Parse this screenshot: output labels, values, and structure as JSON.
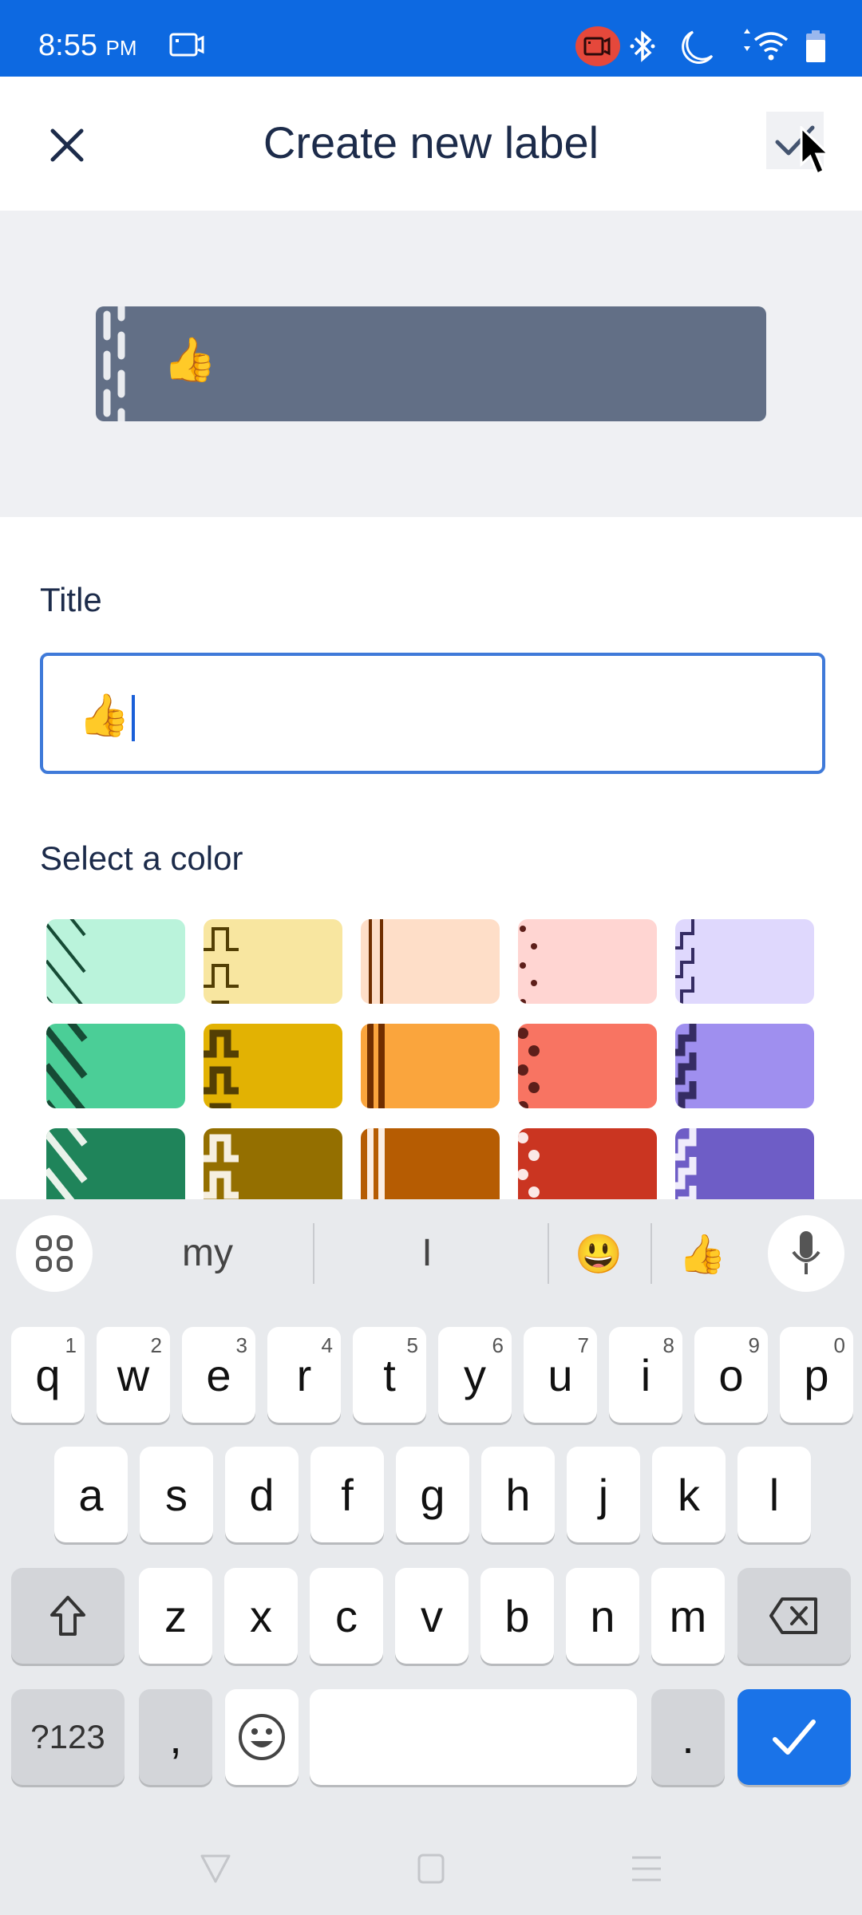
{
  "status_bar": {
    "time": "8:55",
    "ampm": "PM",
    "icons": [
      "screen-record-icon",
      "recording-indicator-icon",
      "bluetooth-icon",
      "do-not-disturb-icon",
      "wifi-icon",
      "battery-icon"
    ]
  },
  "app_bar": {
    "title": "Create new label",
    "close_icon": "close-icon",
    "done_icon": "check-icon"
  },
  "preview": {
    "label_text": "👍",
    "label_color": "#626f86"
  },
  "form": {
    "title_label": "Title",
    "title_value": "👍",
    "color_label": "Select a color"
  },
  "colors": [
    {
      "name": "green-subtle",
      "bg": "#baf3db",
      "pattern": "diagonal",
      "fg": "#164b35"
    },
    {
      "name": "yellow-subtle",
      "bg": "#f8e6a0",
      "pattern": "pulse",
      "fg": "#533f04"
    },
    {
      "name": "orange-subtle",
      "bg": "#fedec8",
      "pattern": "vlines",
      "fg": "#702e00"
    },
    {
      "name": "red-subtle",
      "bg": "#ffd5d2",
      "pattern": "dots",
      "fg": "#5d1f1a"
    },
    {
      "name": "purple-subtle",
      "bg": "#dfd8fd",
      "pattern": "steps",
      "fg": "#352c63"
    },
    {
      "name": "green",
      "bg": "#4bce97",
      "pattern": "diagonal",
      "fg": "#164b35"
    },
    {
      "name": "yellow",
      "bg": "#e2b203",
      "pattern": "pulse",
      "fg": "#533f04"
    },
    {
      "name": "orange",
      "bg": "#faa53d",
      "pattern": "vlines",
      "fg": "#702e00"
    },
    {
      "name": "red",
      "bg": "#f87462",
      "pattern": "dots",
      "fg": "#5d1f1a"
    },
    {
      "name": "purple",
      "bg": "#9f8fef",
      "pattern": "steps",
      "fg": "#352c63"
    },
    {
      "name": "green-bold",
      "bg": "#1f845a",
      "pattern": "diagonal",
      "fg": "#e9f2ea"
    },
    {
      "name": "yellow-bold",
      "bg": "#946f00",
      "pattern": "pulse",
      "fg": "#f6efe0"
    },
    {
      "name": "orange-bold",
      "bg": "#b65c02",
      "pattern": "vlines",
      "fg": "#fbeee4"
    },
    {
      "name": "red-bold",
      "bg": "#ca3521",
      "pattern": "dots",
      "fg": "#fbe8e6"
    },
    {
      "name": "purple-bold",
      "bg": "#6e5dc6",
      "pattern": "steps",
      "fg": "#efecfb"
    }
  ],
  "keyboard": {
    "suggestions": [
      "my",
      "I",
      "😃",
      "👍"
    ],
    "row1": [
      {
        "k": "q",
        "n": "1"
      },
      {
        "k": "w",
        "n": "2"
      },
      {
        "k": "e",
        "n": "3"
      },
      {
        "k": "r",
        "n": "4"
      },
      {
        "k": "t",
        "n": "5"
      },
      {
        "k": "y",
        "n": "6"
      },
      {
        "k": "u",
        "n": "7"
      },
      {
        "k": "i",
        "n": "8"
      },
      {
        "k": "o",
        "n": "9"
      },
      {
        "k": "p",
        "n": "0"
      }
    ],
    "row2": [
      "a",
      "s",
      "d",
      "f",
      "g",
      "h",
      "j",
      "k",
      "l"
    ],
    "row3": [
      "z",
      "x",
      "c",
      "v",
      "b",
      "n",
      "m"
    ],
    "symbols_label": "?123",
    "comma": ",",
    "period": ".",
    "accent_color": "#1a73e8"
  }
}
